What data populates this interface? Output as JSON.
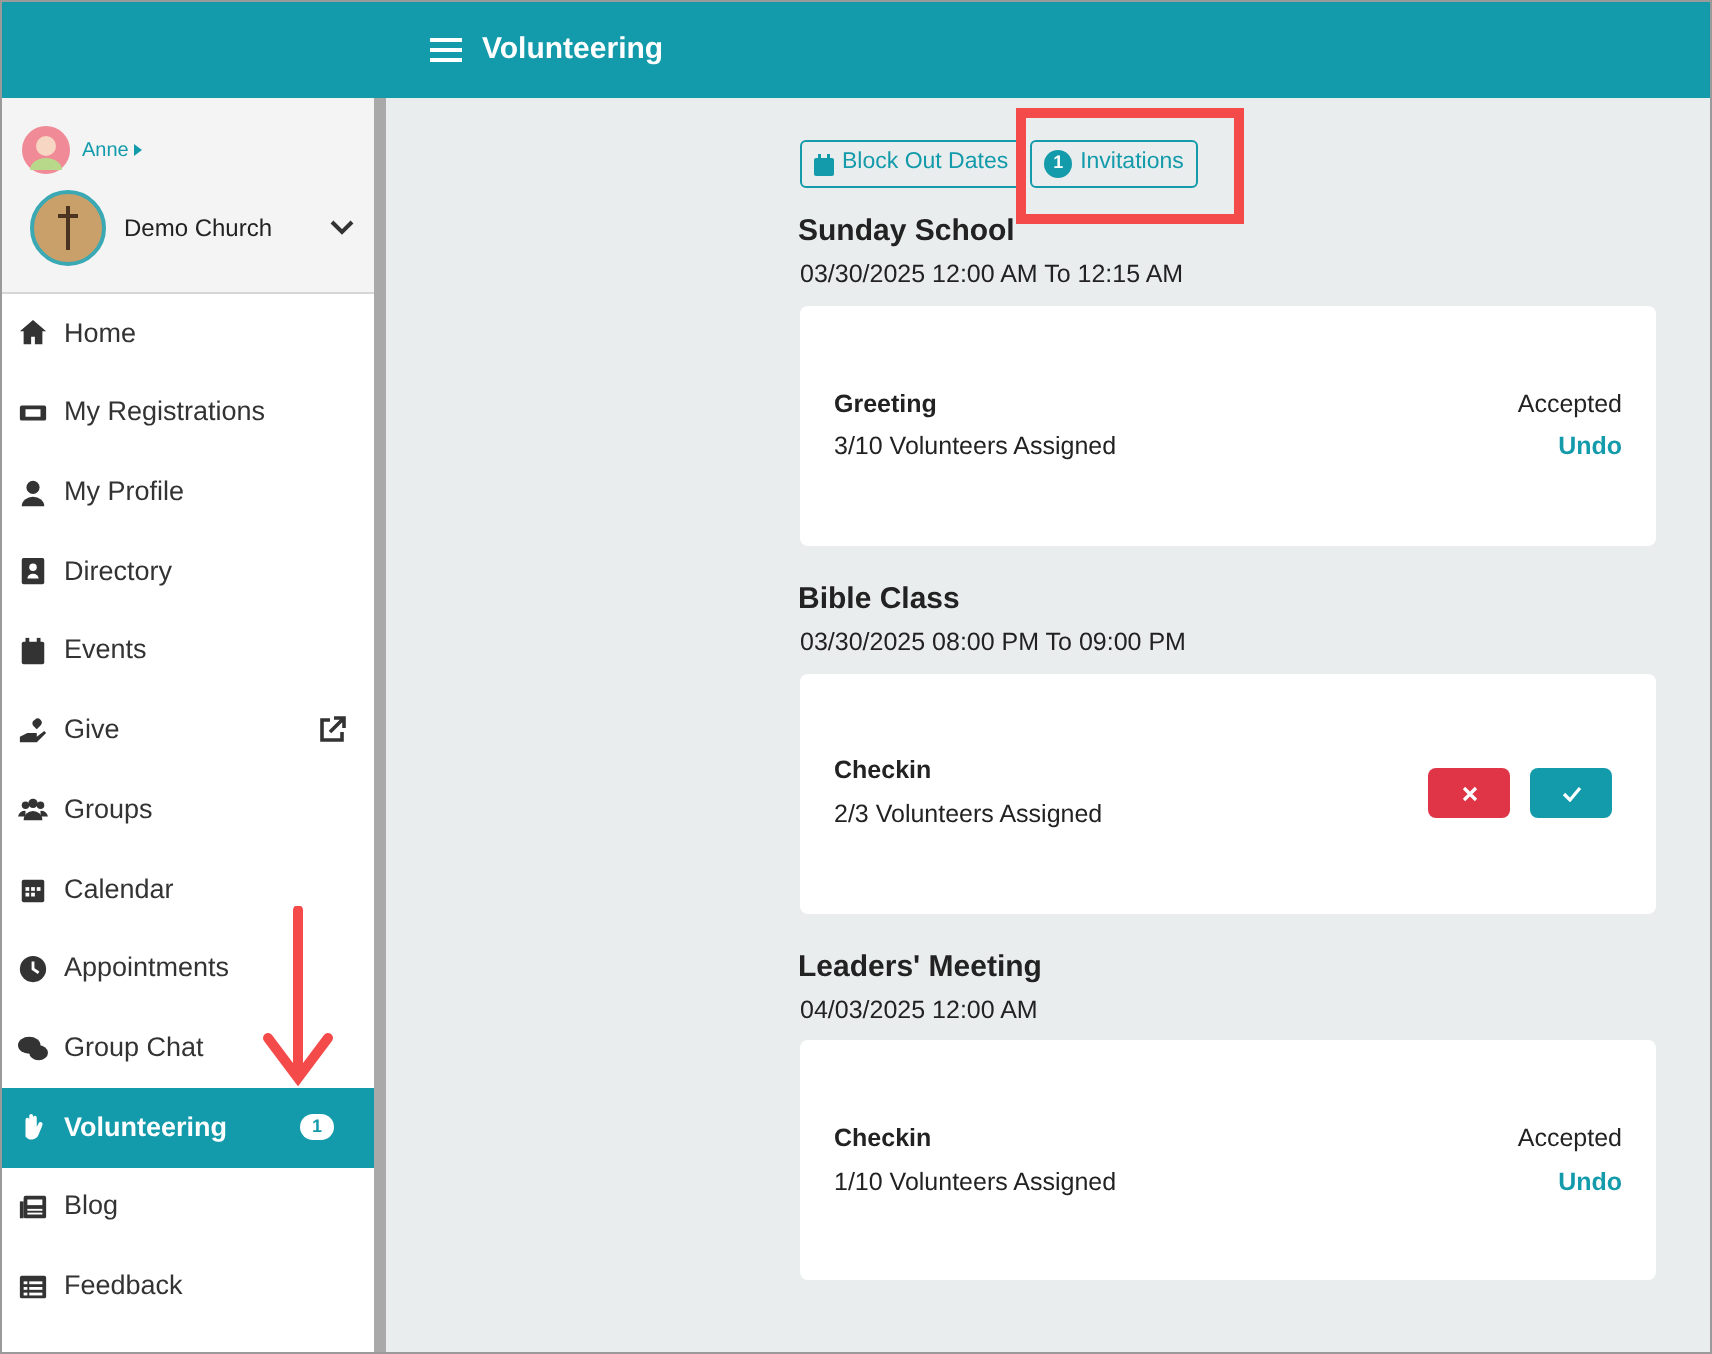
{
  "header": {
    "title": "Volunteering"
  },
  "user": {
    "name": "Anne"
  },
  "church": {
    "name": "Demo Church"
  },
  "sidebar": {
    "items": [
      {
        "label": "Home",
        "selected": false
      },
      {
        "label": "My Registrations",
        "selected": false
      },
      {
        "label": "My Profile",
        "selected": false
      },
      {
        "label": "Directory",
        "selected": false
      },
      {
        "label": "Events",
        "selected": false
      },
      {
        "label": "Give",
        "selected": false,
        "external": true
      },
      {
        "label": "Groups",
        "selected": false
      },
      {
        "label": "Calendar",
        "selected": false
      },
      {
        "label": "Appointments",
        "selected": false
      },
      {
        "label": "Group Chat",
        "selected": false
      },
      {
        "label": "Volunteering",
        "selected": true,
        "badge": "1"
      },
      {
        "label": "Blog",
        "selected": false
      },
      {
        "label": "Feedback",
        "selected": false
      }
    ]
  },
  "tabs": [
    {
      "label": "Block Out Dates",
      "selected": false
    },
    {
      "label": "Invitations",
      "selected": false,
      "badge": "1"
    }
  ],
  "events": [
    {
      "title": "Sunday School",
      "when": "03/30/2025 12:00 AM To 12:15 AM",
      "assignments": [
        {
          "role": "Greeting",
          "count": "3/10 Volunteers Assigned",
          "kind": "accepted",
          "status": "Accepted",
          "action": "Undo"
        }
      ]
    },
    {
      "title": "Bible Class",
      "when": "03/30/2025 08:00 PM To 09:00 PM",
      "assignments": [
        {
          "role": "Checkin",
          "count": "2/3 Volunteers Assigned",
          "kind": "pending"
        }
      ]
    },
    {
      "title": "Leaders' Meeting",
      "when": "04/03/2025 12:00 AM",
      "assignments": [
        {
          "role": "Checkin",
          "count": "1/10 Volunteers Assigned",
          "kind": "accepted",
          "status": "Accepted",
          "action": "Undo"
        }
      ]
    }
  ]
}
